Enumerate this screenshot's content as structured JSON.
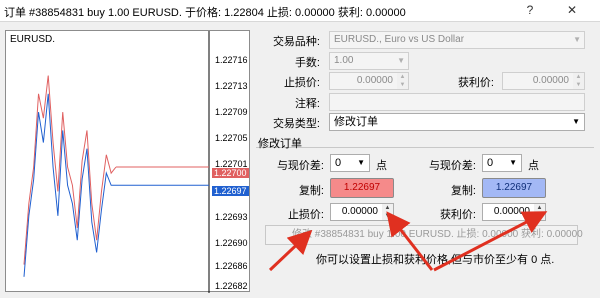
{
  "window": {
    "title": "订单 #38854831 buy 1.00 EURUSD. 于价格: 1.22804 止损: 0.00000 获利: 0.00000",
    "help_glyph": "?",
    "close_glyph": "✕"
  },
  "chart": {
    "symbol": "EURUSD.",
    "y_ticks": [
      "1.22716",
      "1.22713",
      "1.22709",
      "1.22705",
      "1.22701",
      "1.22693",
      "1.22690",
      "1.22686",
      "1.22682"
    ],
    "ask_tag": "1.22700",
    "bid_tag": "1.22697",
    "colors": {
      "ask": "#e06060",
      "bid": "#2060d0",
      "candles_up": "#e06060",
      "candles_down": "#2060d0"
    }
  },
  "chart_data": {
    "type": "line",
    "title": "",
    "ylim": [
      1.2268,
      1.2272
    ],
    "series": [
      {
        "values": [
          1.22684,
          1.22694,
          1.227,
          1.22712,
          1.22708,
          1.22715,
          1.22704,
          1.22696,
          1.22709,
          1.227,
          1.22697,
          1.2269,
          1.22701,
          1.22706,
          1.22694,
          1.22688,
          1.22696,
          1.22702,
          1.22699,
          1.227
        ]
      },
      {
        "values": [
          1.22682,
          1.22692,
          1.22698,
          1.22709,
          1.22704,
          1.22712,
          1.227,
          1.22692,
          1.22706,
          1.22697,
          1.22694,
          1.22688,
          1.22698,
          1.22703,
          1.22691,
          1.22686,
          1.22693,
          1.22699,
          1.22697,
          1.22697
        ]
      }
    ],
    "lines": {
      "ask": 1.227,
      "bid": 1.22697
    }
  },
  "form": {
    "symbol_label": "交易品种:",
    "symbol_value": "EURUSD., Euro vs US Dollar",
    "volume_label": "手数:",
    "volume_value": "1.00",
    "sl_label": "止损价:",
    "sl_value": "0.00000",
    "tp_label": "获利价:",
    "tp_value": "0.00000",
    "comment_label": "注释:",
    "comment_value": "",
    "type_label": "交易类型:",
    "type_value": "修改订单"
  },
  "modify": {
    "group_title": "修改订单",
    "left": {
      "diff_label": "与现价差:",
      "diff_value": "0",
      "unit": "点",
      "copy_label": "复制:",
      "copy_value": "1.22697",
      "price_label": "止损价:",
      "price_value": "0.00000"
    },
    "right": {
      "diff_label": "与现价差:",
      "diff_value": "0",
      "unit": "点",
      "copy_label": "复制:",
      "copy_value": "1.22697",
      "price_label": "获利价:",
      "price_value": "0.00000"
    },
    "button_label": "修改 #38854831 buy 1.00 EURUSD. 止损: 0.00000 获利: 0.00000",
    "hint": "你可以设置止损和获利价格,但与市价至少有 0 点."
  }
}
